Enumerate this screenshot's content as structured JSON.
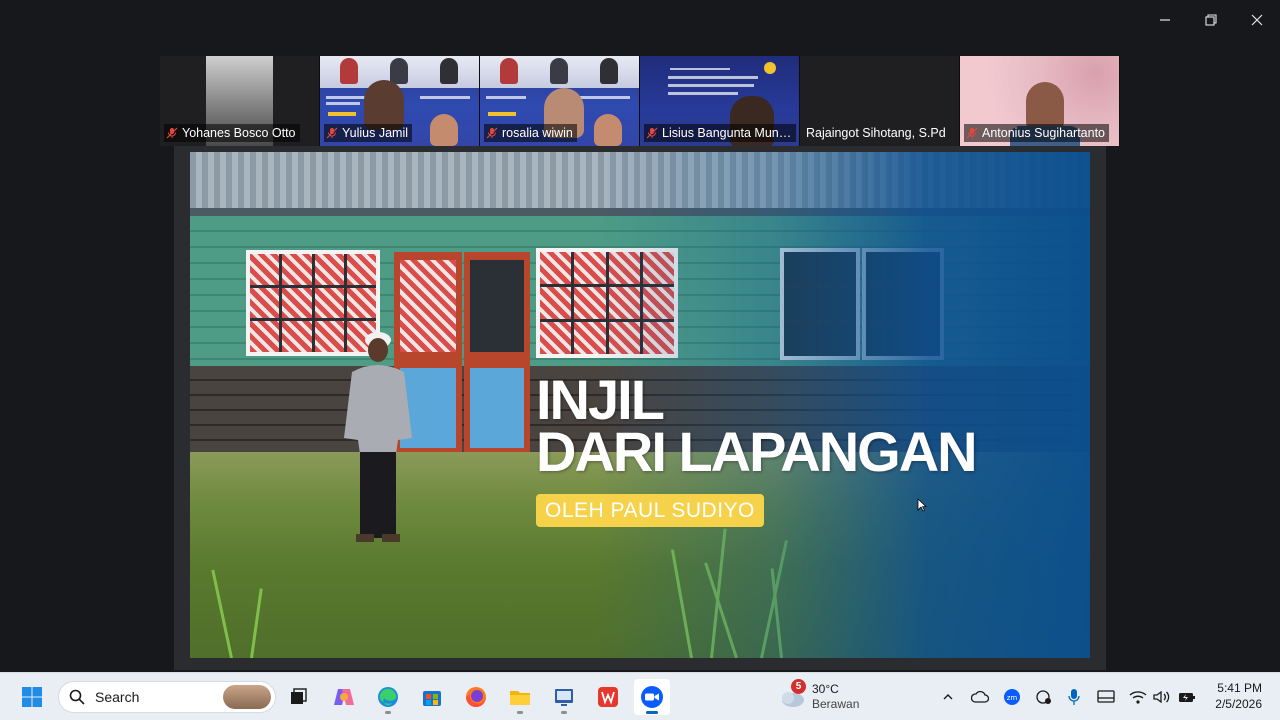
{
  "window": {
    "minimize_icon": "minimize-icon",
    "restore_icon": "restore-icon",
    "close_icon": "close-icon"
  },
  "participants": [
    {
      "name": "Yohanes Bosco Otto",
      "muted": true
    },
    {
      "name": "Yulius Jamil",
      "muted": true
    },
    {
      "name": "rosalia wiwin",
      "muted": true
    },
    {
      "name": "Lisius Bangunta Munt...",
      "muted": true
    },
    {
      "name": "Rajaingot Sihotang, S.Pd",
      "muted": false
    },
    {
      "name": "Antonius Sugihartanto",
      "muted": true
    }
  ],
  "slide": {
    "title_line1": "INJIL",
    "title_line2": "DARI LAPANGAN",
    "subtitle": "OLEH PAUL SUDIYO"
  },
  "taskbar": {
    "search_label": "Search",
    "weather": {
      "alerts": "5",
      "temp": "30°C",
      "condition": "Berawan"
    },
    "clock": {
      "time": "5:41 PM",
      "date": "2/5/2026"
    }
  },
  "colors": {
    "accent": "#0067c0",
    "muted_icon": "#e5483b",
    "subtitle_bg": "#f6d24a",
    "slide_overlay": "#0c508f"
  }
}
